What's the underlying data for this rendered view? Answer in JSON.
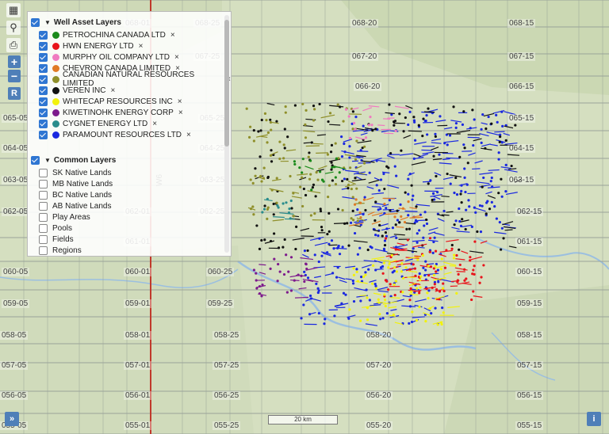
{
  "well_panel": {
    "title": "Well Asset Layers",
    "layers": [
      {
        "label": "PETROCHINA CANADA LTD",
        "color": "#1a8a1a",
        "checked": true
      },
      {
        "label": "HWN ENERGY LTD",
        "color": "#e8141b",
        "checked": true
      },
      {
        "label": "MURPHY OIL COMPANY LTD",
        "color": "#f07ac0",
        "checked": true
      },
      {
        "label": "CHEVRON CANADA LIMITED",
        "color": "#e07a25",
        "checked": true
      },
      {
        "label": "CANADIAN NATURAL RESOURCES LIMITED",
        "color": "#8f8f2a",
        "checked": true
      },
      {
        "label": "VEREN INC",
        "color": "#111111",
        "checked": true
      },
      {
        "label": "WHITECAP RESOURCES INC",
        "color": "#f2f20c",
        "checked": true
      },
      {
        "label": "KIWETINOHK ENERGY CORP",
        "color": "#7d1a8c",
        "checked": true
      },
      {
        "label": "CYGNET ENERGY LTD",
        "color": "#2a8c8c",
        "checked": true
      },
      {
        "label": "PARAMOUNT RESOURCES LTD",
        "color": "#1a28e0",
        "checked": true
      }
    ],
    "remove_symbol": "×"
  },
  "common_panel": {
    "title": "Common Layers",
    "layers": [
      "SK Native Lands",
      "MB Native Lands",
      "BC Native Lands",
      "AB Native Lands",
      "Play Areas",
      "Pools",
      "Fields",
      "Regions"
    ]
  },
  "grid_labels": [
    "068-01",
    "068-25",
    "068-20",
    "068-15",
    "067-25",
    "067-20",
    "067-15",
    "066-20",
    "066-15",
    "065-15",
    "064-15",
    "063-15",
    "062-01",
    "062-15",
    "061-01",
    "061-15",
    "060-01",
    "060-25",
    "060-15",
    "059-01",
    "059-25",
    "059-15",
    "058-05",
    "058-01",
    "058-25",
    "058-20",
    "058-15",
    "057-05",
    "057-01",
    "057-25",
    "057-20",
    "057-15",
    "056-05",
    "056-01",
    "056-25",
    "056-20",
    "056-15",
    "055-05",
    "055-01",
    "055-25",
    "055-20",
    "055-15",
    "065-25",
    "064-25",
    "063-25",
    "062-25",
    "063-05",
    "065-05",
    "064-05",
    "062-05",
    "059-05",
    "060-05"
  ],
  "meridian_label": "W6",
  "scale_label": "20 km",
  "buttons": {
    "zoom_in": "+",
    "zoom_out": "−",
    "reset": "R",
    "expand": "»",
    "info": "i"
  },
  "colors": {
    "map_bg": "#d5dfc0",
    "grid": "#9aa39a",
    "meridian": "#c0392b",
    "river": "#9bbfe0"
  }
}
